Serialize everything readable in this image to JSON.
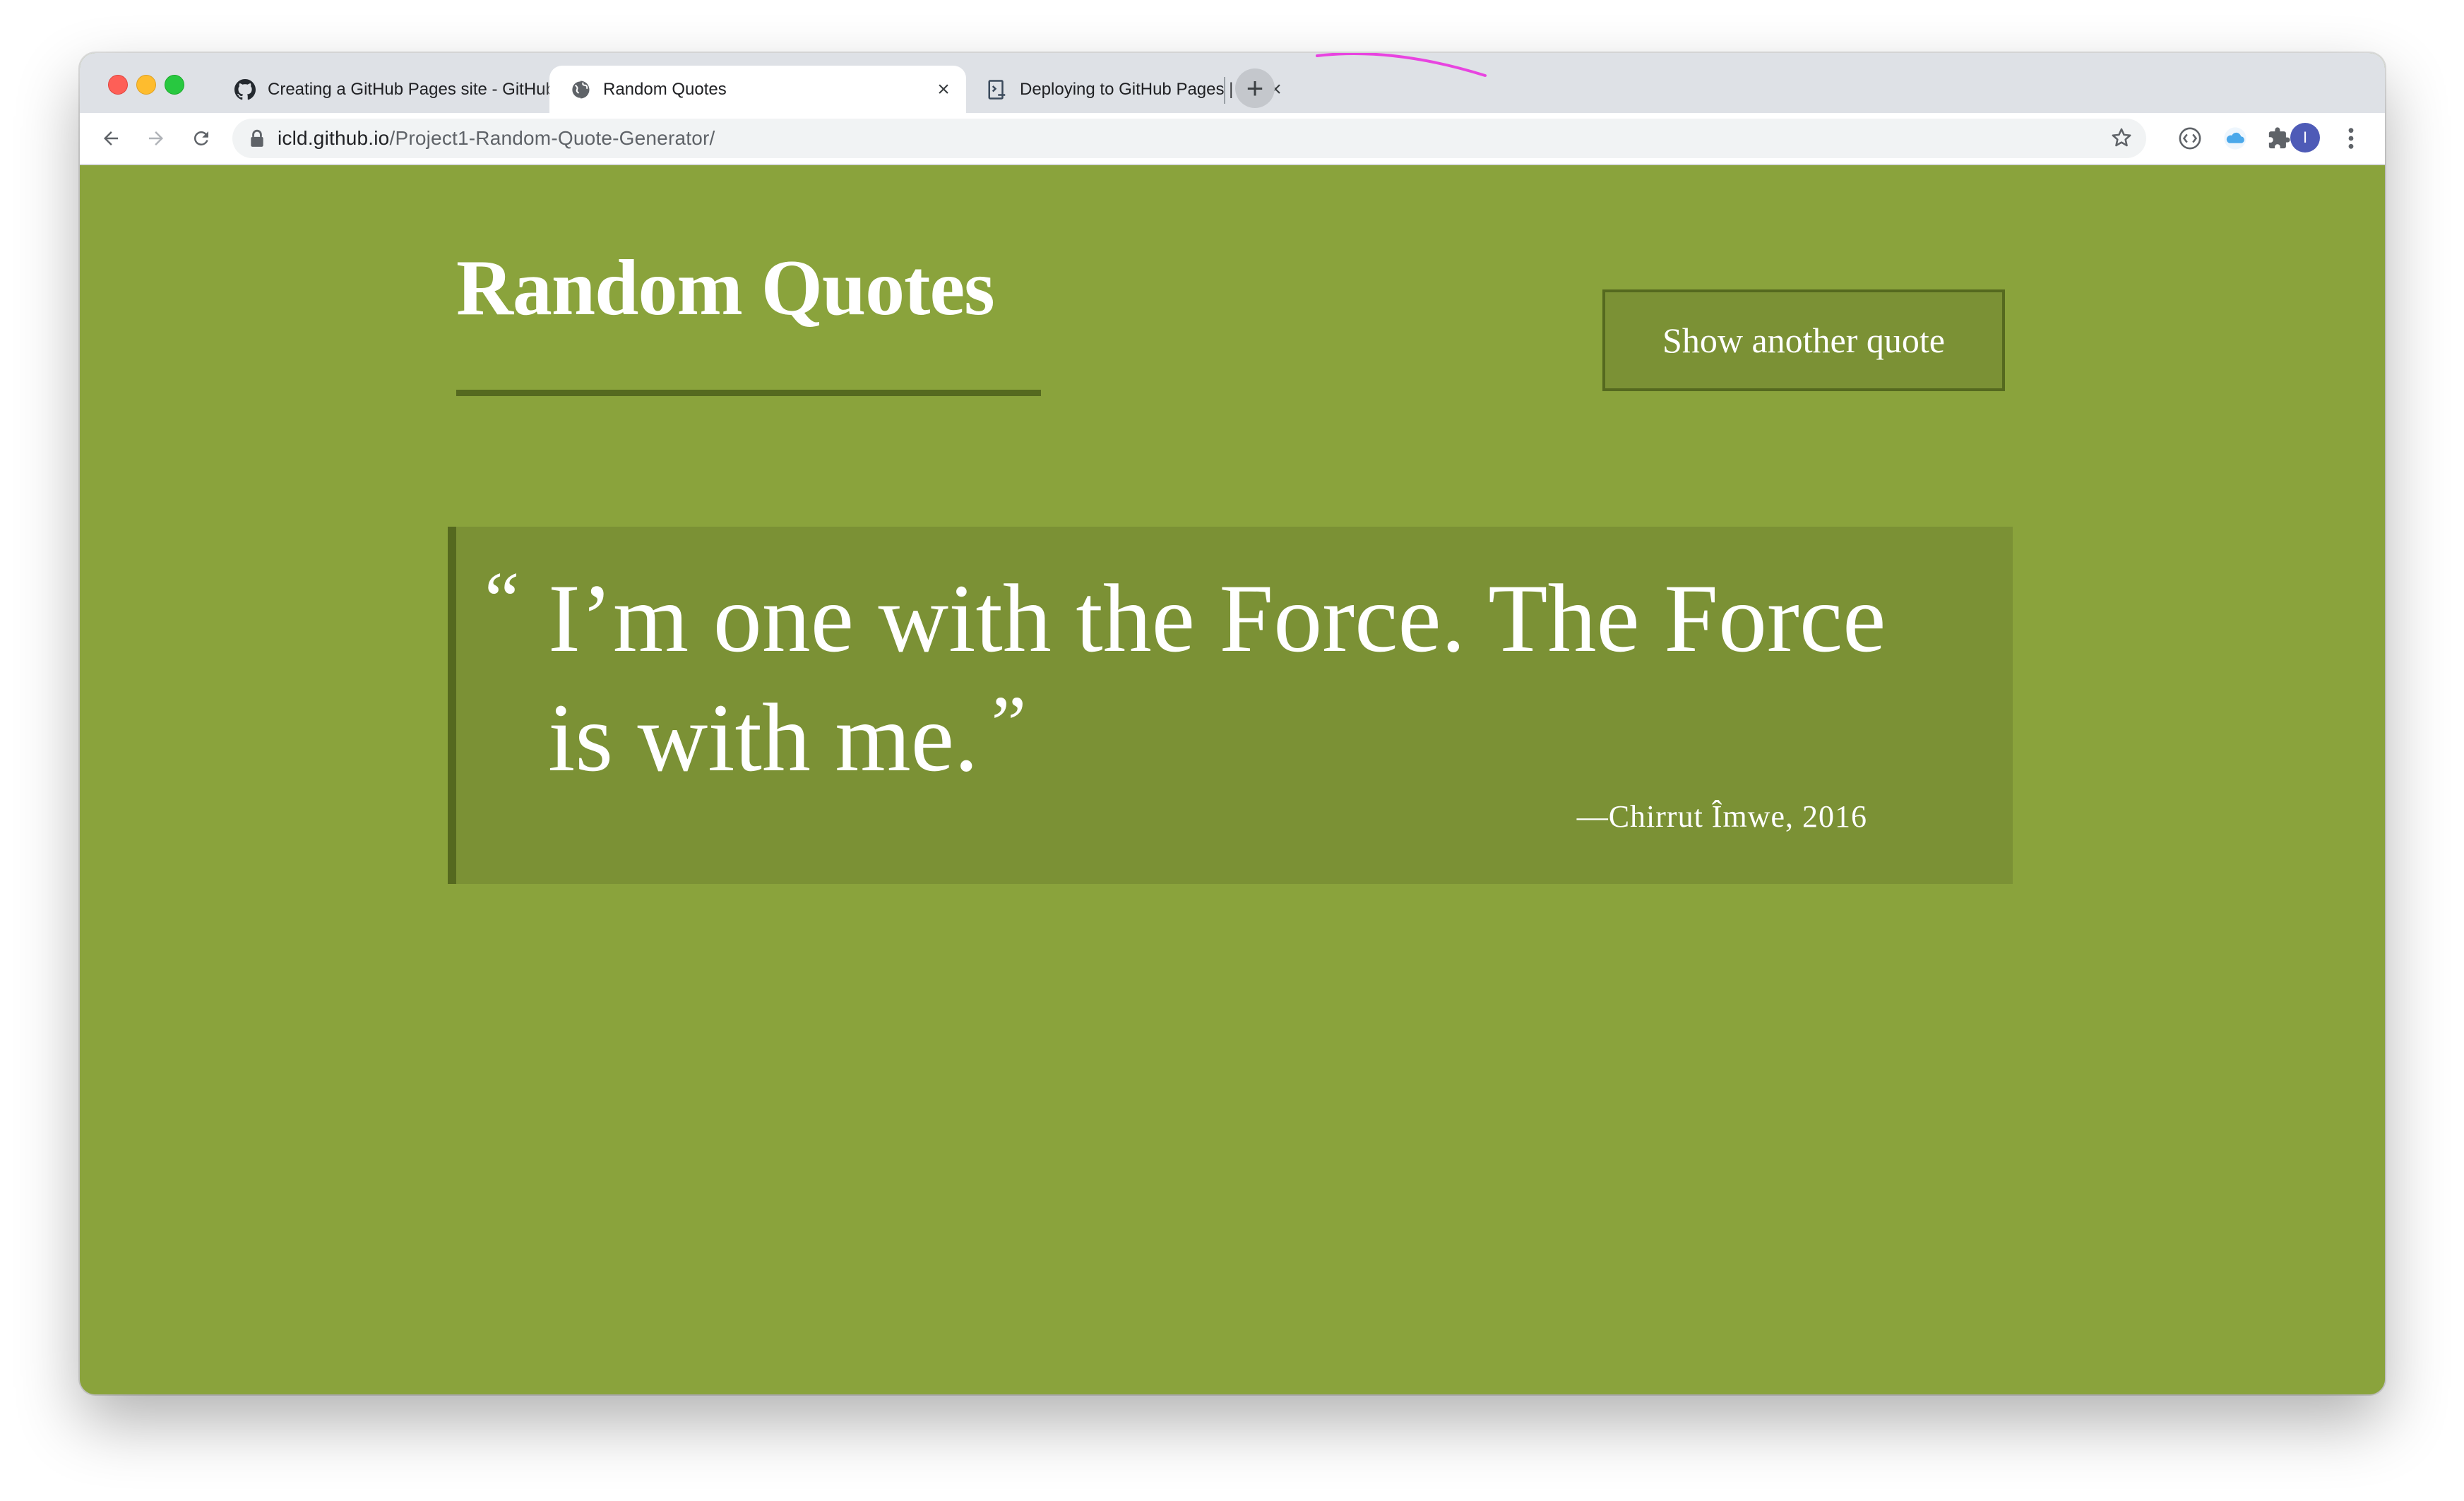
{
  "browser": {
    "tabs": [
      {
        "title": "Creating a GitHub Pages site - GitHub Docs",
        "favicon": "github-icon",
        "active": false
      },
      {
        "title": "Random Quotes",
        "favicon": "globe-icon",
        "active": true
      },
      {
        "title": "Deploying to GitHub Pages | Create React App",
        "favicon": "docs-icon",
        "active": false
      }
    ],
    "close_glyph": "×",
    "new_tab_glyph": "+",
    "url_host": "icld.github.io",
    "url_path": "/Project1-Random-Quote-Generator/",
    "profile_initial": "I",
    "accent_colors": {
      "avatar": "#4e5bb7",
      "cloud_extension": "#4aa8ea",
      "scribble": "#e844e0"
    }
  },
  "page": {
    "title": "Random Quotes",
    "button_label": "Show another quote",
    "quote": {
      "open_mark": "“",
      "text": "I’m one with the Force. The Force is with me.",
      "close_mark": "”",
      "source": "—Chirrut Îmwe, 2016"
    },
    "colors": {
      "background": "#8aa33c",
      "panel": "#7b9135",
      "accent_dark": "#55691f",
      "text": "#ffffff"
    }
  }
}
